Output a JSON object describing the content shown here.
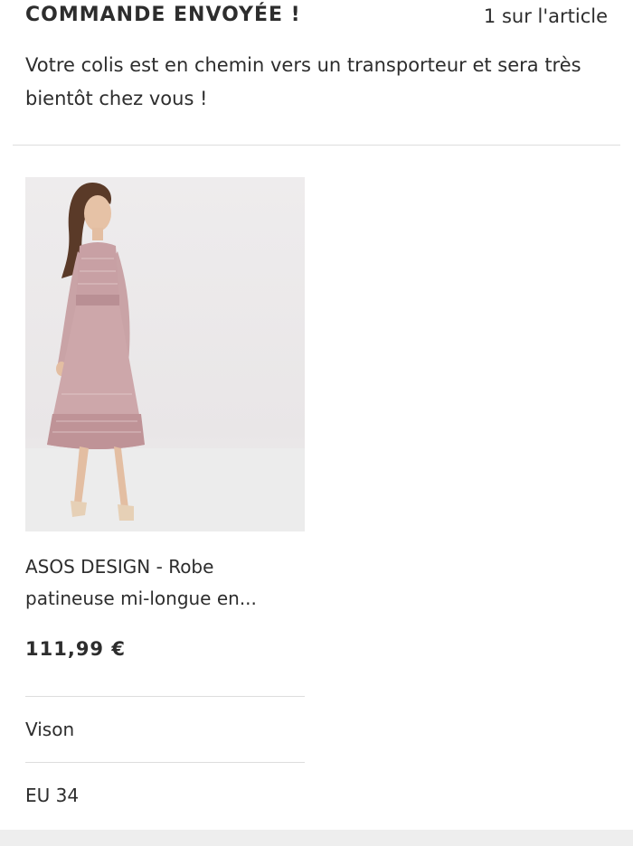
{
  "header": {
    "title": "COMMANDE ENVOYÉE !",
    "item_count": "1 sur l'article"
  },
  "message": "Votre colis est en chemin vers un transporteur et sera très bientôt chez vous !",
  "product": {
    "name": "ASOS DESIGN - Robe patineuse mi-longue en...",
    "price": "111,99 €",
    "colour": "Vison",
    "size": "EU 34",
    "image_description": "model-in-pink-lace-midi-dress"
  },
  "colors": {
    "text": "#2d2d2d",
    "divider": "#dddddd",
    "dress": "#c9a3a6",
    "background": "#ffffff"
  }
}
